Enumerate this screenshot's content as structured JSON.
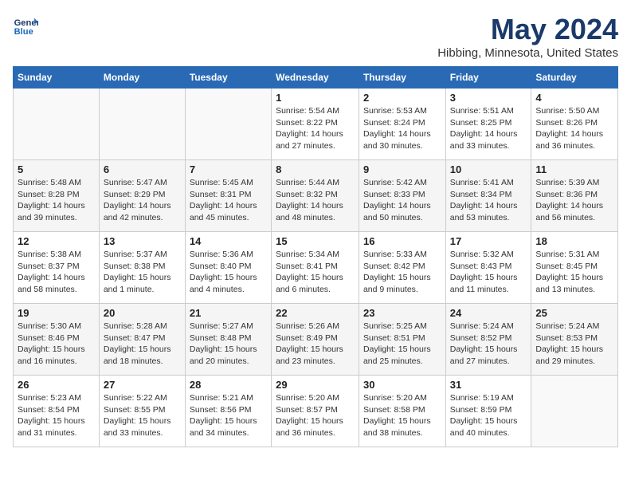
{
  "header": {
    "logo_line1": "General",
    "logo_line2": "Blue",
    "month_year": "May 2024",
    "location": "Hibbing, Minnesota, United States"
  },
  "weekdays": [
    "Sunday",
    "Monday",
    "Tuesday",
    "Wednesday",
    "Thursday",
    "Friday",
    "Saturday"
  ],
  "weeks": [
    [
      {
        "day": "",
        "info": ""
      },
      {
        "day": "",
        "info": ""
      },
      {
        "day": "",
        "info": ""
      },
      {
        "day": "1",
        "info": "Sunrise: 5:54 AM\nSunset: 8:22 PM\nDaylight: 14 hours\nand 27 minutes."
      },
      {
        "day": "2",
        "info": "Sunrise: 5:53 AM\nSunset: 8:24 PM\nDaylight: 14 hours\nand 30 minutes."
      },
      {
        "day": "3",
        "info": "Sunrise: 5:51 AM\nSunset: 8:25 PM\nDaylight: 14 hours\nand 33 minutes."
      },
      {
        "day": "4",
        "info": "Sunrise: 5:50 AM\nSunset: 8:26 PM\nDaylight: 14 hours\nand 36 minutes."
      }
    ],
    [
      {
        "day": "5",
        "info": "Sunrise: 5:48 AM\nSunset: 8:28 PM\nDaylight: 14 hours\nand 39 minutes."
      },
      {
        "day": "6",
        "info": "Sunrise: 5:47 AM\nSunset: 8:29 PM\nDaylight: 14 hours\nand 42 minutes."
      },
      {
        "day": "7",
        "info": "Sunrise: 5:45 AM\nSunset: 8:31 PM\nDaylight: 14 hours\nand 45 minutes."
      },
      {
        "day": "8",
        "info": "Sunrise: 5:44 AM\nSunset: 8:32 PM\nDaylight: 14 hours\nand 48 minutes."
      },
      {
        "day": "9",
        "info": "Sunrise: 5:42 AM\nSunset: 8:33 PM\nDaylight: 14 hours\nand 50 minutes."
      },
      {
        "day": "10",
        "info": "Sunrise: 5:41 AM\nSunset: 8:34 PM\nDaylight: 14 hours\nand 53 minutes."
      },
      {
        "day": "11",
        "info": "Sunrise: 5:39 AM\nSunset: 8:36 PM\nDaylight: 14 hours\nand 56 minutes."
      }
    ],
    [
      {
        "day": "12",
        "info": "Sunrise: 5:38 AM\nSunset: 8:37 PM\nDaylight: 14 hours\nand 58 minutes."
      },
      {
        "day": "13",
        "info": "Sunrise: 5:37 AM\nSunset: 8:38 PM\nDaylight: 15 hours\nand 1 minute."
      },
      {
        "day": "14",
        "info": "Sunrise: 5:36 AM\nSunset: 8:40 PM\nDaylight: 15 hours\nand 4 minutes."
      },
      {
        "day": "15",
        "info": "Sunrise: 5:34 AM\nSunset: 8:41 PM\nDaylight: 15 hours\nand 6 minutes."
      },
      {
        "day": "16",
        "info": "Sunrise: 5:33 AM\nSunset: 8:42 PM\nDaylight: 15 hours\nand 9 minutes."
      },
      {
        "day": "17",
        "info": "Sunrise: 5:32 AM\nSunset: 8:43 PM\nDaylight: 15 hours\nand 11 minutes."
      },
      {
        "day": "18",
        "info": "Sunrise: 5:31 AM\nSunset: 8:45 PM\nDaylight: 15 hours\nand 13 minutes."
      }
    ],
    [
      {
        "day": "19",
        "info": "Sunrise: 5:30 AM\nSunset: 8:46 PM\nDaylight: 15 hours\nand 16 minutes."
      },
      {
        "day": "20",
        "info": "Sunrise: 5:28 AM\nSunset: 8:47 PM\nDaylight: 15 hours\nand 18 minutes."
      },
      {
        "day": "21",
        "info": "Sunrise: 5:27 AM\nSunset: 8:48 PM\nDaylight: 15 hours\nand 20 minutes."
      },
      {
        "day": "22",
        "info": "Sunrise: 5:26 AM\nSunset: 8:49 PM\nDaylight: 15 hours\nand 23 minutes."
      },
      {
        "day": "23",
        "info": "Sunrise: 5:25 AM\nSunset: 8:51 PM\nDaylight: 15 hours\nand 25 minutes."
      },
      {
        "day": "24",
        "info": "Sunrise: 5:24 AM\nSunset: 8:52 PM\nDaylight: 15 hours\nand 27 minutes."
      },
      {
        "day": "25",
        "info": "Sunrise: 5:24 AM\nSunset: 8:53 PM\nDaylight: 15 hours\nand 29 minutes."
      }
    ],
    [
      {
        "day": "26",
        "info": "Sunrise: 5:23 AM\nSunset: 8:54 PM\nDaylight: 15 hours\nand 31 minutes."
      },
      {
        "day": "27",
        "info": "Sunrise: 5:22 AM\nSunset: 8:55 PM\nDaylight: 15 hours\nand 33 minutes."
      },
      {
        "day": "28",
        "info": "Sunrise: 5:21 AM\nSunset: 8:56 PM\nDaylight: 15 hours\nand 34 minutes."
      },
      {
        "day": "29",
        "info": "Sunrise: 5:20 AM\nSunset: 8:57 PM\nDaylight: 15 hours\nand 36 minutes."
      },
      {
        "day": "30",
        "info": "Sunrise: 5:20 AM\nSunset: 8:58 PM\nDaylight: 15 hours\nand 38 minutes."
      },
      {
        "day": "31",
        "info": "Sunrise: 5:19 AM\nSunset: 8:59 PM\nDaylight: 15 hours\nand 40 minutes."
      },
      {
        "day": "",
        "info": ""
      }
    ]
  ]
}
